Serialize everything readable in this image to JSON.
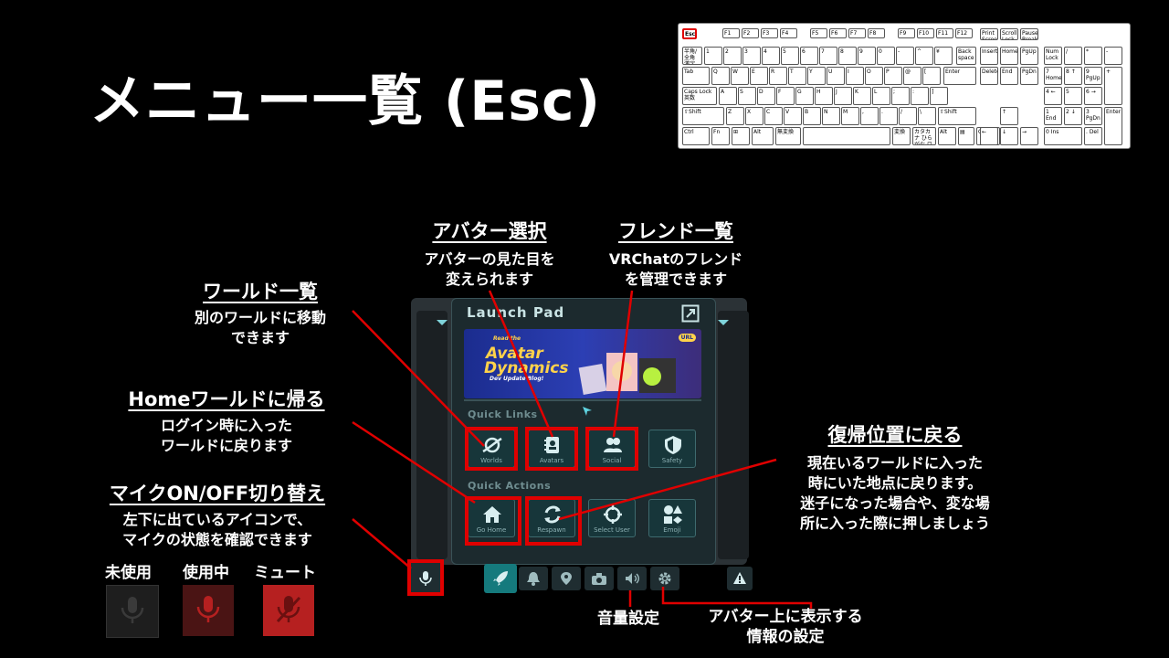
{
  "page_title": "メニュー一覧 (Esc)",
  "keyboard": {
    "row0": [
      "Esc",
      "F1",
      "F2",
      "F3",
      "F4",
      "F5",
      "F6",
      "F7",
      "F8",
      "F9",
      "F10",
      "F11",
      "F12",
      "Print Screen",
      "Scroll Lock",
      "Pause Break"
    ],
    "row1": [
      "半角/全角 漢字",
      "1",
      "2",
      "3",
      "4",
      "5",
      "6",
      "7",
      "8",
      "9",
      "0",
      "-",
      "^",
      "¥",
      "Back space",
      "Insert",
      "Home",
      "PgUp",
      "Num Lock",
      "/",
      "*",
      "-"
    ],
    "row2": [
      "Tab",
      "Q",
      "W",
      "E",
      "R",
      "T",
      "Y",
      "U",
      "I",
      "O",
      "P",
      "@",
      "[",
      "Enter",
      "Delete",
      "End",
      "PgDn",
      "7 Home",
      "8 ↑",
      "9 PgUp",
      "+"
    ],
    "row3": [
      "Caps Lock 英数",
      "A",
      "S",
      "D",
      "F",
      "G",
      "H",
      "J",
      "K",
      "L",
      ";",
      ":",
      "]",
      "4 ←",
      "5",
      "6 →"
    ],
    "row4": [
      "⇧Shift",
      "Z",
      "X",
      "C",
      "V",
      "B",
      "N",
      "M",
      ",",
      ".",
      "/",
      "\\",
      "⇧Shift",
      "↑",
      "1 End",
      "2 ↓",
      "3 PgDn",
      "Enter"
    ],
    "row5": [
      "Ctrl",
      "Fn",
      "⊞",
      "Alt",
      "無変換",
      "",
      "変換",
      "カタカナ ひらがな ローマ字",
      "Alt",
      "▤",
      "Ctrl",
      "←",
      "↓",
      "→",
      "0 Ins",
      ". Del"
    ]
  },
  "launch_pad": {
    "title": "Launch Pad",
    "banner": {
      "small": "Read the",
      "big1": "Avatar",
      "big2": "Dynamics",
      "sub": "Dev Update Blog!",
      "badge": "URL"
    },
    "quick_links_label": "Quick Links",
    "quick_links": [
      "Worlds",
      "Avatars",
      "Social",
      "Safety"
    ],
    "quick_actions_label": "Quick Actions",
    "quick_actions": [
      "Go Home",
      "Respawn",
      "Select User",
      "Emoji"
    ]
  },
  "annotations": {
    "avatar": {
      "heading": "アバター選択",
      "line1": "アバターの見た目を",
      "line2": "変えられます"
    },
    "friends": {
      "heading": "フレンド一覧",
      "line1": "VRChatのフレンド",
      "line2": "を管理できます"
    },
    "worlds": {
      "heading": "ワールド一覧",
      "line1": "別のワールドに移動",
      "line2": "できます"
    },
    "home": {
      "heading": "Homeワールドに帰る",
      "line1": "ログイン時に入った",
      "line2": "ワールドに戻ります"
    },
    "mic": {
      "heading": "マイクON/OFF切り替え",
      "line1": "左下に出ているアイコンで、",
      "line2": "マイクの状態を確認できます"
    },
    "respawn": {
      "heading": "復帰位置に戻る",
      "line1": "現在いるワールドに入った",
      "line2": "時にいた地点に戻ります。",
      "line3": "迷子になった場合や、変な場",
      "line4": "所に入った際に押しましょう"
    },
    "volume": {
      "label": "音量設定"
    },
    "avatar_info": {
      "line1": "アバター上に表示する",
      "line2": "情報の設定"
    }
  },
  "mic_states": {
    "unused": "未使用",
    "in_use": "使用中",
    "mute": "ミュート"
  },
  "colors": {
    "highlight": "#e00000",
    "teal": "#157a7d",
    "panel": "#1c2a2e"
  }
}
